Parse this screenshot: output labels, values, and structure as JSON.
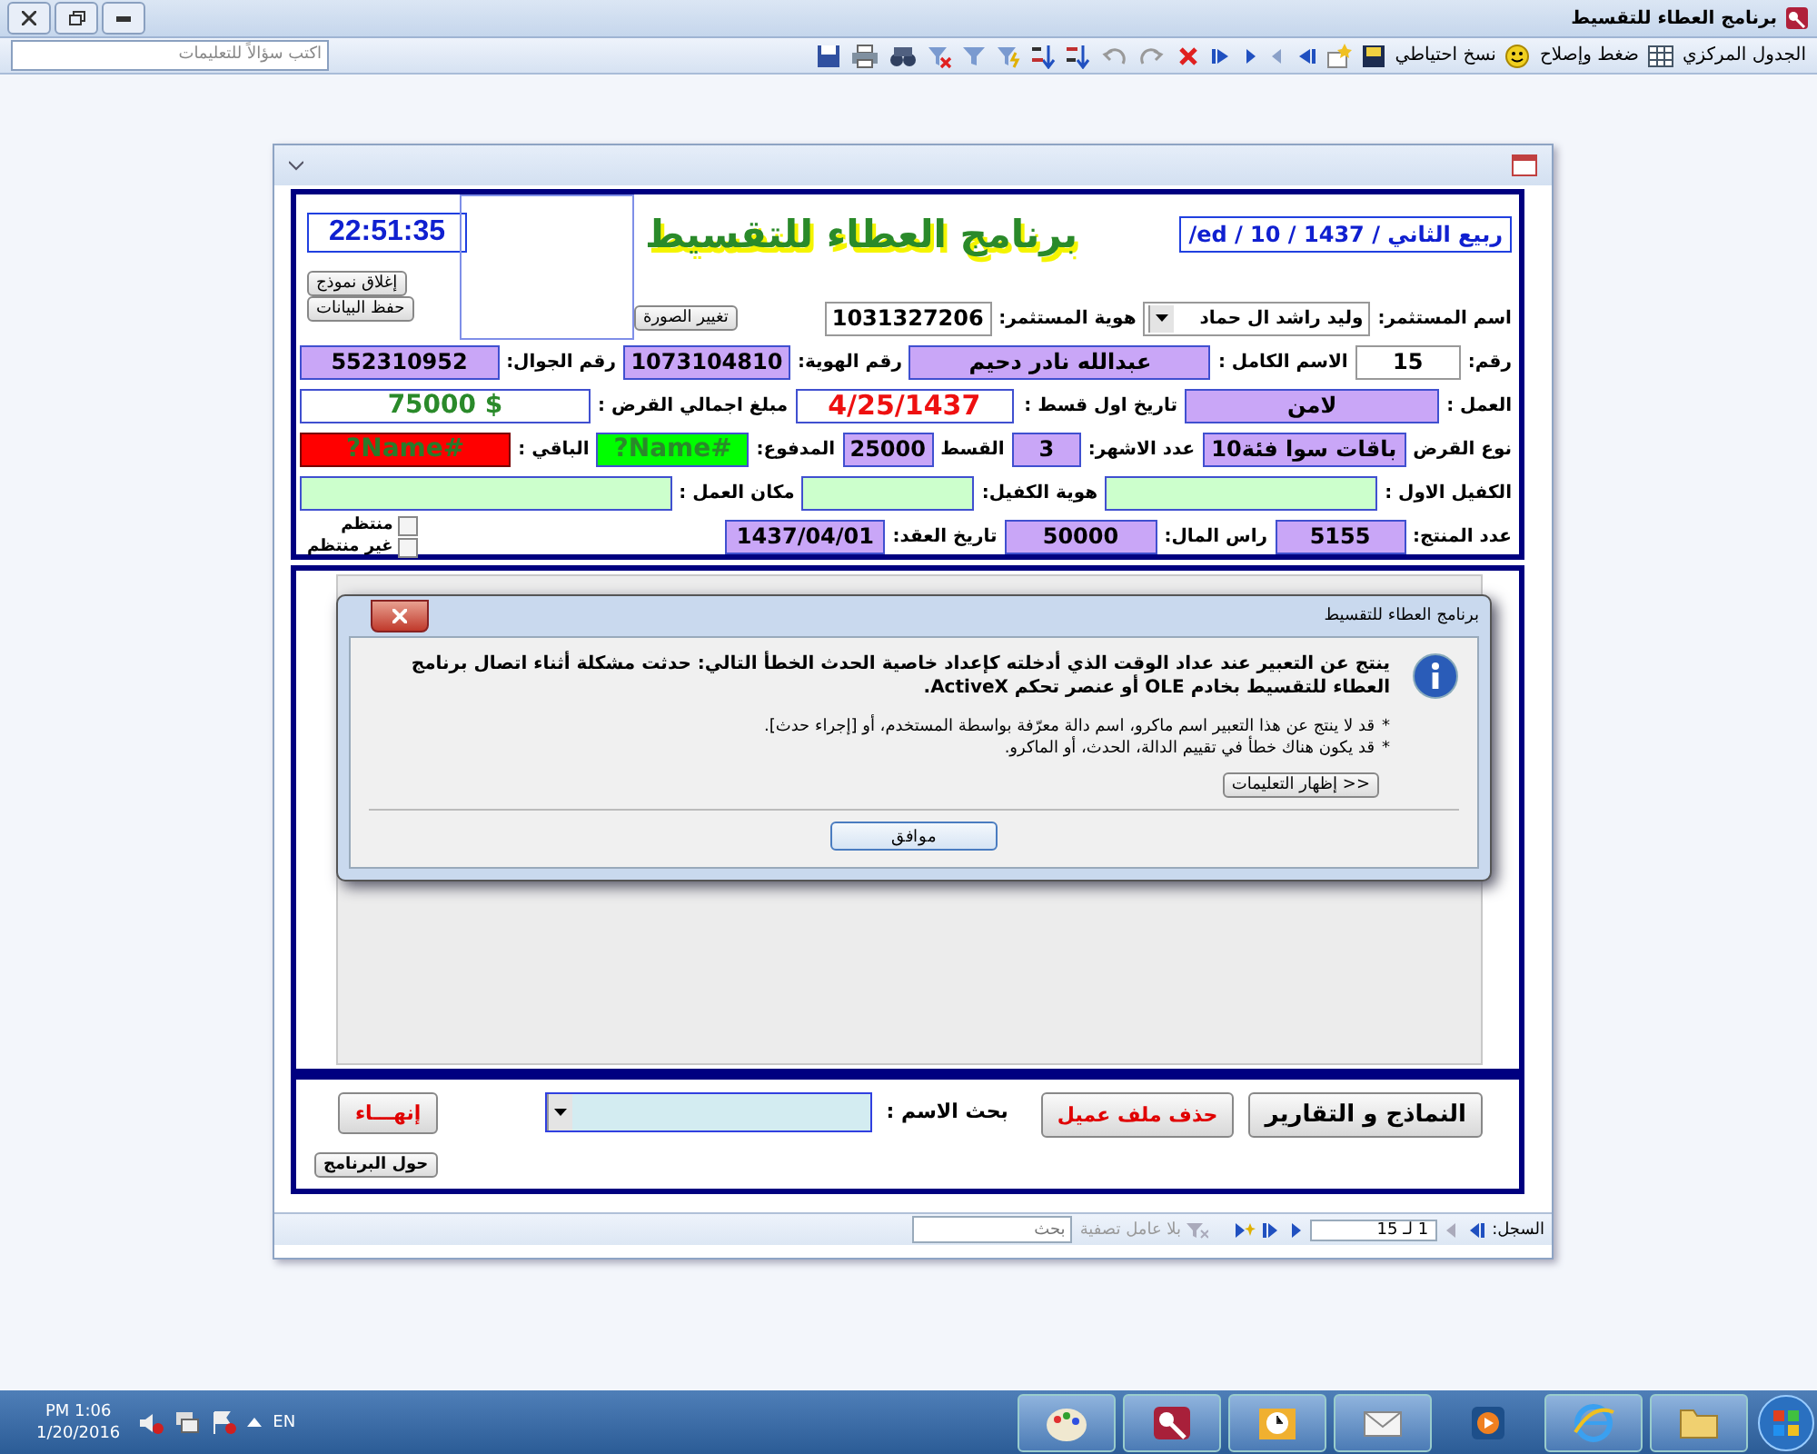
{
  "app_title": "برنامج العطاء للتقسيط",
  "toolbar": {
    "labels": [
      "الجدول المركزي",
      "ضغط وإصلاح",
      "نسخ احتياطي"
    ],
    "help": {
      "placeholder": "اكتب سؤالاً للتعليمات"
    }
  },
  "form": {
    "date": "/ed / 10 / 1437 / ربيع الثاني",
    "clock": "22:51:35",
    "logo": "برنامج العطاء للتقسيط",
    "close_button": "إغلاق نموذج",
    "save_button": "حفظ البيانات",
    "change_image_button": "تغيير الصورة",
    "rows": [
      {
        "fields": [
          {
            "label": "اسم المستثمر:",
            "value": "وليد راشد ال حماد",
            "kind": "combo"
          },
          {
            "label": "هوية المستثمر:",
            "value": "1031327206",
            "kind": "input"
          }
        ]
      },
      {
        "fields": [
          {
            "label": "رقم:",
            "value": "15",
            "kind": "input"
          },
          {
            "label": "الاسم الكامل :",
            "value": "عبدالله نادر دحيم",
            "kind": "display"
          },
          {
            "label": "رقم الهوية:",
            "value": "1073104810",
            "kind": "display"
          },
          {
            "label": "رقم الجوال:",
            "value": "552310952",
            "kind": "display"
          }
        ]
      },
      {
        "fields": [
          {
            "label": "العمل :",
            "value": "لامن",
            "kind": "display"
          },
          {
            "label": "تاريخ اول قسط :",
            "value": "4/25/1437",
            "kind": "date"
          },
          {
            "label": "مبلغ اجمالي القرض :",
            "value": "$ 75000",
            "kind": "amount"
          }
        ]
      },
      {
        "fields": [
          {
            "label": "نوع القرض",
            "value": "باقات سوا فئة10",
            "kind": "display"
          },
          {
            "label": "عدد الاشهر:",
            "value": "3",
            "kind": "display"
          },
          {
            "label": "القسط",
            "value": "25000",
            "kind": "display"
          },
          {
            "label": "المدفوع:",
            "value": "#Name?",
            "kind": "good"
          },
          {
            "label": "الباقي :",
            "value": "#Name?",
            "kind": "bad"
          }
        ]
      },
      {
        "fields": [
          {
            "label": "الكفيل الاول :",
            "kind": "blank"
          },
          {
            "label": "هوية الكفيل:",
            "kind": "blank"
          },
          {
            "label": "مكان العمل :",
            "kind": "blank"
          }
        ]
      },
      {
        "fields": [
          {
            "label": "عدد المنتج:",
            "value": "5155",
            "kind": "display"
          },
          {
            "label": "راس المال:",
            "value": "50000",
            "kind": "display"
          },
          {
            "label": "تاريخ العقد:",
            "value": "1437/04/01",
            "kind": "display"
          }
        ],
        "checks": [
          {
            "label": "منتظم",
            "checked": false
          },
          {
            "label": "غير منتظم",
            "checked": false
          }
        ]
      }
    ],
    "footer": {
      "reports_button": "النماذج و التقارير",
      "delete_button": "حذف ملف عميل",
      "search_label": "بحث الاسم :",
      "exit_button": "إنهـــاء",
      "about_button": "حول البرنامج"
    },
    "record_bar": {
      "label": "السجل:",
      "position": "1 لـ 15",
      "filter": "بلا عامل تصفية",
      "search": {
        "placeholder": "بحث"
      }
    }
  },
  "dialog": {
    "title": "برنامج العطاء للتقسيط",
    "message": "ينتج عن التعبير عند عداد الوقت الذي أدخلته كإعداد خاصية الحدث الخطأ التالي: حدثت مشكلة أثناء اتصال برنامج العطاء للتقسيط بخادم OLE أو عنصر تحكم ActiveX.",
    "bullets": [
      {
        "mark": "*",
        "text": "قد لا ينتج عن هذا التعبير اسم ماكرو، اسم دالة معرّفة بواسطة المستخدم، أو [إجراء حدث]."
      },
      {
        "mark": "*",
        "text": "قد يكون هناك خطأ في تقييم الدالة، الحدث، أو الماكرو."
      }
    ],
    "details_button": "إظهار التعليمات >>",
    "ok_button": "موافق"
  },
  "taskbar": {
    "time": "PM 1:06",
    "date": "1/20/2016",
    "language": "EN"
  }
}
